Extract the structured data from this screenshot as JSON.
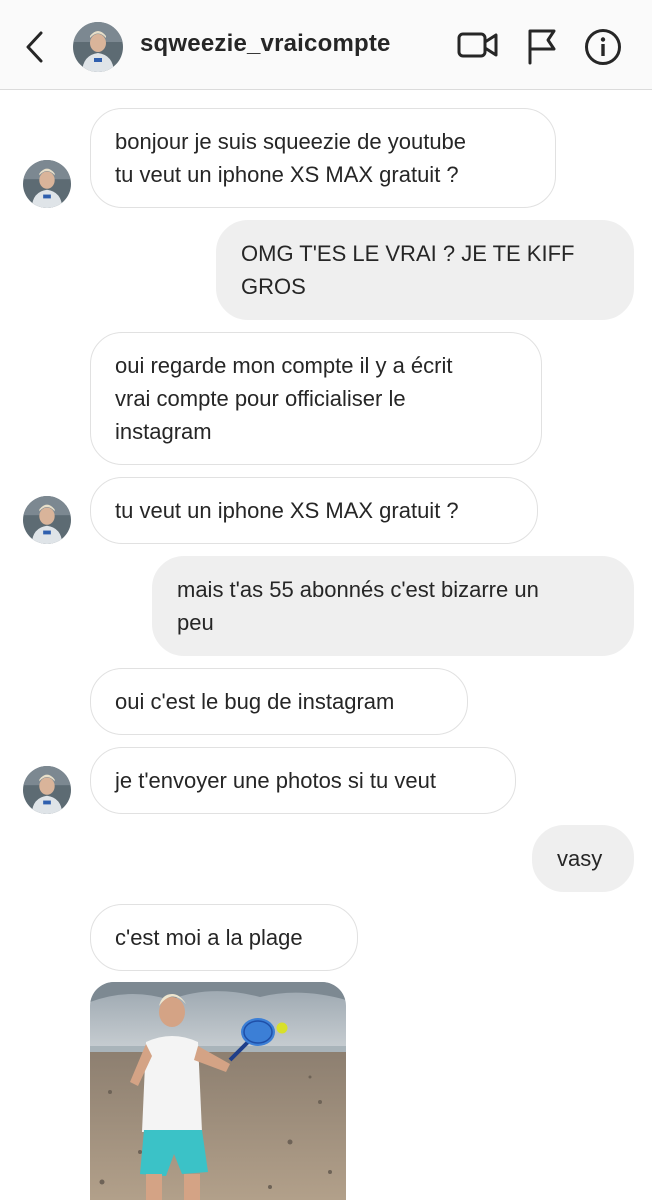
{
  "header": {
    "username": "sqweezie_vraicompte",
    "icons": [
      "back-chevron-icon",
      "video-call-icon",
      "flag-icon",
      "info-icon"
    ]
  },
  "messages": [
    {
      "from": "them",
      "text": "bonjour je suis squeezie de youtube\ntu veut un iphone XS MAX gratuit ?"
    },
    {
      "from": "me",
      "text": "OMG T'ES LE VRAI ? JE TE KIFF\nGROS"
    },
    {
      "from": "them",
      "text": "oui regarde mon compte il y a écrit\nvrai compte pour officialiser le\ninstagram"
    },
    {
      "from": "them",
      "text": "tu veut un iphone XS MAX gratuit ?"
    },
    {
      "from": "me",
      "text": "mais t'as 55 abonnés c'est bizarre un\npeu"
    },
    {
      "from": "them",
      "text": "oui c'est le bug de instagram"
    },
    {
      "from": "them",
      "text": "je t'envoyer une photos si tu veut"
    },
    {
      "from": "me",
      "text": "vasy"
    },
    {
      "from": "them",
      "text": "c'est moi a la plage"
    }
  ],
  "colors": {
    "header_bg": "#fafafa",
    "incoming_border": "#e1e1e1",
    "outgoing_bg": "#efefef",
    "text": "#262626"
  }
}
